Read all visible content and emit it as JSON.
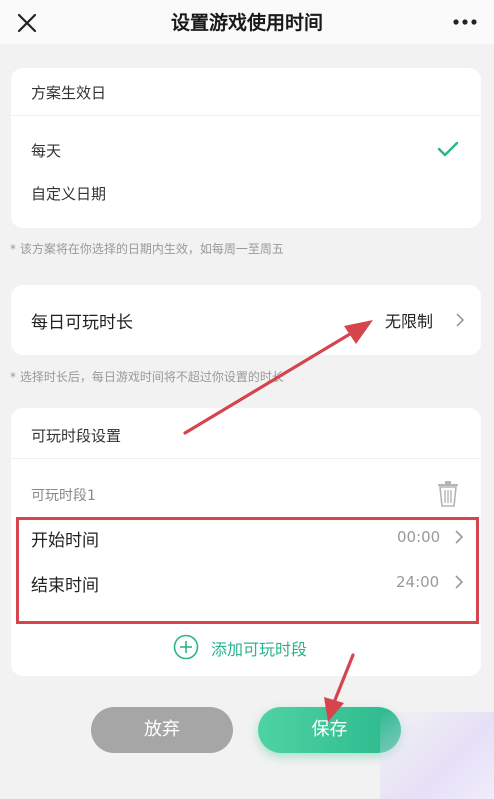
{
  "header": {
    "title": "设置游戏使用时间",
    "close_icon": "close-icon",
    "more_icon": "more-icon"
  },
  "effective_days": {
    "section_title": "方案生效日",
    "options": [
      {
        "label": "每天",
        "selected": true
      },
      {
        "label": "自定义日期",
        "selected": false
      }
    ],
    "hint": "* 该方案将在你选择的日期内生效，如每周一至周五"
  },
  "daily_duration": {
    "label": "每日可玩时长",
    "value": "无限制",
    "hint": "* 选择时长后，每日游戏时间将不超过你设置的时长"
  },
  "play_periods": {
    "section_title": "可玩时段设置",
    "slot_label": "可玩时段1",
    "start": {
      "label": "开始时间",
      "value": "00:00"
    },
    "end": {
      "label": "结束时间",
      "value": "24:00"
    },
    "add_label": "添加可玩时段"
  },
  "actions": {
    "discard_label": "放弃",
    "save_label": "保存"
  },
  "colors": {
    "accent": "#29b58b",
    "annotation_red": "#d6454e",
    "discard_gray": "#a6a6a6"
  }
}
